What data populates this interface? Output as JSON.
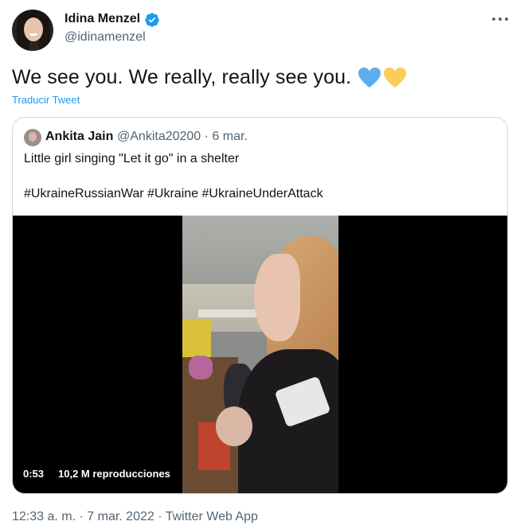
{
  "author": {
    "display_name": "Idina Menzel",
    "handle": "@idinamenzel",
    "verified": true
  },
  "tweet": {
    "text": "We see you. We really, really see you.",
    "emojis": [
      "blue-heart-icon",
      "yellow-heart-icon"
    ],
    "translate_label": "Traducir Tweet",
    "timestamp": "12:33 a. m. · 7 mar. 2022 · Twitter Web App"
  },
  "quoted": {
    "display_name": "Ankita Jain",
    "meta": "@Ankita20200 · 6 mar.",
    "text": "Little girl singing \"Let it go\" in a shelter",
    "hashtags": "#UkraineRussianWar #Ukraine #UkraineUnderAttack",
    "video": {
      "duration": "0:53",
      "views": "10,2 M reproducciones"
    }
  },
  "colors": {
    "accent": "#1d9bf0",
    "text_primary": "#0f1419",
    "text_secondary": "#536471",
    "border": "#cfd9de",
    "heart_blue": "#5dadec",
    "heart_yellow": "#fdcb58"
  },
  "icons": {
    "more": "more-options-icon",
    "verified": "verified-badge-icon"
  }
}
